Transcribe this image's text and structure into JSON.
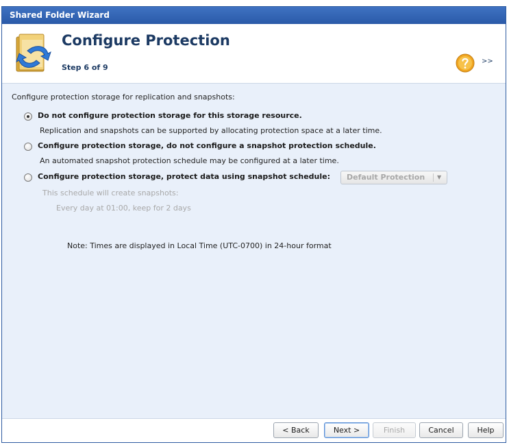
{
  "window": {
    "title": "Shared Folder Wizard"
  },
  "header": {
    "title": "Configure Protection",
    "step": "Step 6 of 9",
    "more_label": ">>"
  },
  "body": {
    "intro": "Configure protection storage for replication and snapshots:",
    "options": [
      {
        "label": "Do not configure protection storage for this storage resource.",
        "description": "Replication and snapshots can be supported by allocating protection space at a later time.",
        "selected": true
      },
      {
        "label": "Configure protection storage, do not configure a snapshot protection schedule.",
        "description": "An automated snapshot protection schedule may be configured at a later time.",
        "selected": false
      },
      {
        "label": "Configure protection storage, protect data using snapshot schedule:",
        "selected": false
      }
    ],
    "schedule_select": {
      "value": "Default Protection",
      "enabled": false
    },
    "schedule_intro": "This schedule will create snapshots:",
    "schedule_detail": "Every day at 01:00, keep for 2 days",
    "note": "Note: Times are displayed in Local Time (UTC-0700) in 24-hour format"
  },
  "footer": {
    "back": "< Back",
    "next": "Next >",
    "finish": "Finish",
    "cancel": "Cancel",
    "help": "Help"
  },
  "colors": {
    "titlebar": "#2a5aa8",
    "body_background": "#e9f0fa",
    "heading_text": "#1c3a63"
  }
}
